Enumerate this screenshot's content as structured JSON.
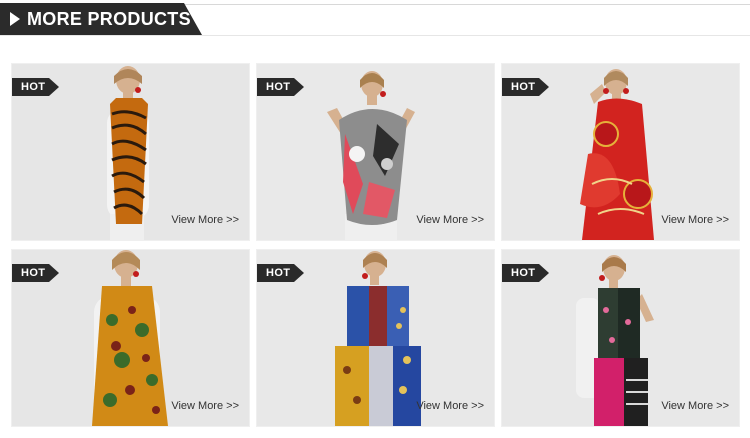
{
  "section": {
    "title": "MORE PRODUCTS"
  },
  "products": [
    {
      "badge": "HOT",
      "link": "View More >>",
      "scarf": "tiger-stripe"
    },
    {
      "badge": "HOT",
      "link": "View More >>",
      "scarf": "gray-red-floral"
    },
    {
      "badge": "HOT",
      "link": "View More >>",
      "scarf": "red-chain-print"
    },
    {
      "badge": "HOT",
      "link": "View More >>",
      "scarf": "paisley-orange"
    },
    {
      "badge": "HOT",
      "link": "View More >>",
      "scarf": "blue-patchwork"
    },
    {
      "badge": "HOT",
      "link": "View More >>",
      "scarf": "pink-floral-patch"
    }
  ],
  "colors": {
    "header_bg": "#2b2b2b",
    "badge_bg": "#2a2a2a",
    "card_bg": "#e7e7e7"
  }
}
